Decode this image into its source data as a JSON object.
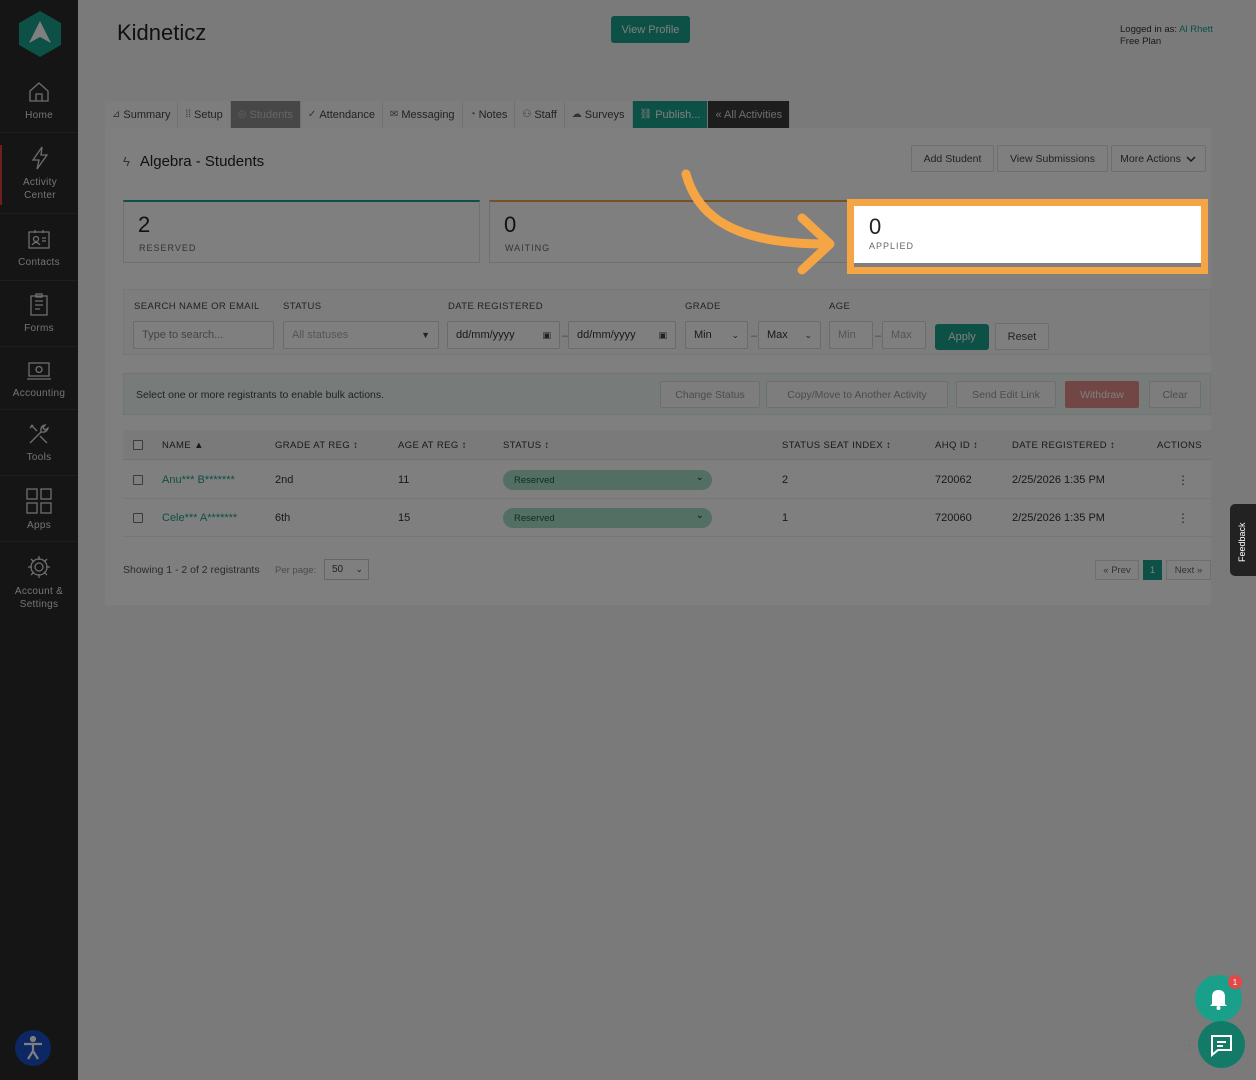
{
  "sidebar": {
    "items": [
      {
        "label": "Home",
        "icon": "home-icon"
      },
      {
        "label": "Activity Center",
        "icon": "bolt-icon"
      },
      {
        "label": "Contacts",
        "icon": "contacts-icon"
      },
      {
        "label": "Forms",
        "icon": "forms-icon"
      },
      {
        "label": "Accounting",
        "icon": "accounting-icon"
      },
      {
        "label": "Tools",
        "icon": "tools-icon"
      },
      {
        "label": "Apps",
        "icon": "apps-icon"
      },
      {
        "label": "Account & Settings",
        "icon": "gear-icon"
      }
    ]
  },
  "header": {
    "org_name": "Kidneticz",
    "view_profile": "View Profile",
    "logged_in_label": "Logged in as:",
    "user_name": "Al Rhett",
    "plan": "Free Plan"
  },
  "tabs": [
    {
      "label": "Summary",
      "icon": "⊿"
    },
    {
      "label": "Setup",
      "icon": "⁞⁞"
    },
    {
      "label": "Students",
      "icon": "◎"
    },
    {
      "label": "Attendance",
      "icon": "✓"
    },
    {
      "label": "Messaging",
      "icon": "✉"
    },
    {
      "label": "Notes",
      "icon": "◔"
    },
    {
      "label": "Staff",
      "icon": "⚇"
    },
    {
      "label": "Surveys",
      "icon": "☁"
    },
    {
      "label": "Publish...",
      "icon": "🔗"
    },
    {
      "label": "« All Activities",
      "icon": ""
    }
  ],
  "panel": {
    "title": "Algebra - Students",
    "add_student": "Add Student",
    "view_submissions": "View Submissions",
    "more_actions": "More Actions"
  },
  "stats": [
    {
      "value": "2",
      "label": "RESERVED",
      "color": "#1aa08a"
    },
    {
      "value": "0",
      "label": "WAITING",
      "color": "#e8a54a"
    },
    {
      "value": "0",
      "label": "APPLIED",
      "color": "#f6a545"
    }
  ],
  "filters": {
    "search_label": "SEARCH NAME OR EMAIL",
    "search_placeholder": "Type to search...",
    "status_label": "STATUS",
    "status_value": "All statuses",
    "date_label": "DATE REGISTERED",
    "date_from": "dd/mm/yyyy",
    "date_to": "dd/mm/yyyy",
    "grade_label": "GRADE",
    "grade_min": "Min",
    "grade_max": "Max",
    "age_label": "AGE",
    "age_min": "Min",
    "age_max": "Max",
    "apply": "Apply",
    "reset": "Reset"
  },
  "bulk": {
    "message": "Select one or more registrants to enable bulk actions.",
    "change_status": "Change Status",
    "copy_move": "Copy/Move to Another Activity",
    "send_edit_link": "Send Edit Link",
    "withdraw": "Withdraw",
    "clear": "Clear"
  },
  "table": {
    "headers": [
      "NAME ▲",
      "GRADE AT REG ↕",
      "AGE AT REG ↕",
      "STATUS ↕",
      "STATUS SEAT INDEX ↕",
      "AHQ ID ↕",
      "DATE REGISTERED ↕",
      "ACTIONS"
    ],
    "rows": [
      {
        "name": "Anu*** B*******",
        "grade": "2nd",
        "age": "11",
        "status": "Reserved",
        "seat": "2",
        "id": "720062",
        "date": "2/25/2026 1:35 PM"
      },
      {
        "name": "Cele*** A*******",
        "grade": "6th",
        "age": "15",
        "status": "Reserved",
        "seat": "1",
        "id": "720060",
        "date": "2/25/2026 1:35 PM"
      }
    ]
  },
  "footer": {
    "showing": "Showing 1 - 2 of 2 registrants",
    "per_page_label": "Per page:",
    "per_page": "50",
    "prev": "« Prev",
    "page": "1",
    "next": "Next »"
  },
  "widgets": {
    "feedback": "Feedback",
    "bell_count": "1"
  }
}
